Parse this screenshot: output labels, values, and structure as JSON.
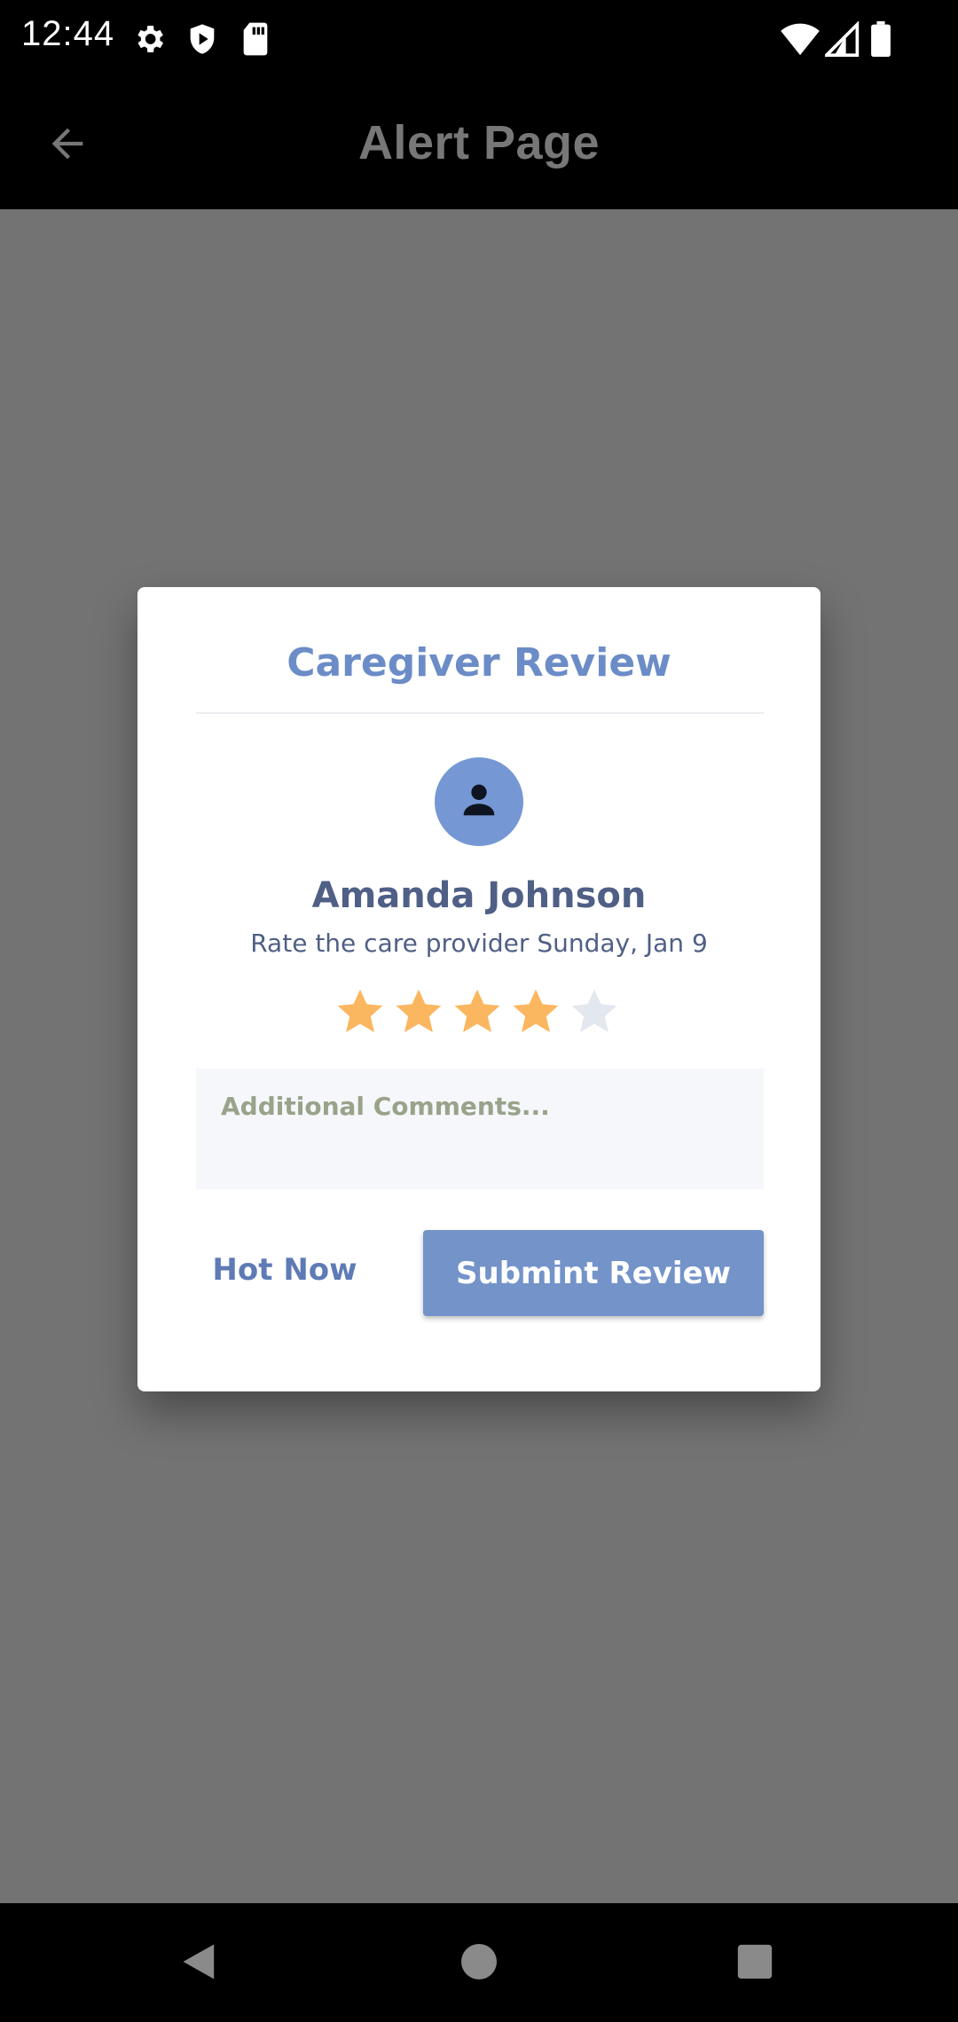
{
  "status_bar": {
    "time": "12:44",
    "icons_left": [
      "settings-icon",
      "shield-play-icon",
      "sd-card-icon"
    ],
    "icons_right": [
      "wifi-icon",
      "signal-icon",
      "battery-icon"
    ]
  },
  "app_bar": {
    "title": "Alert Page",
    "back_icon": "arrow-left-icon"
  },
  "dialog": {
    "title": "Caregiver Review",
    "avatar_icon": "person-icon",
    "name": "Amanda Johnson",
    "subtitle": "Rate the care provider Sunday, Jan 9",
    "rating": {
      "value": 4,
      "max": 5,
      "filled_color": "#fbb660",
      "empty_color": "#e3e7ee"
    },
    "comments": {
      "placeholder": "Additional Comments...",
      "value": ""
    },
    "secondary_button": "Hot Now",
    "primary_button": "Submint Review"
  },
  "colors": {
    "accent": "#6b8cc7",
    "primary_button": "#7393c9",
    "scrim": "#737373"
  },
  "nav_bar": {
    "buttons": [
      "back-triangle-icon",
      "home-circle-icon",
      "recents-square-icon"
    ]
  }
}
